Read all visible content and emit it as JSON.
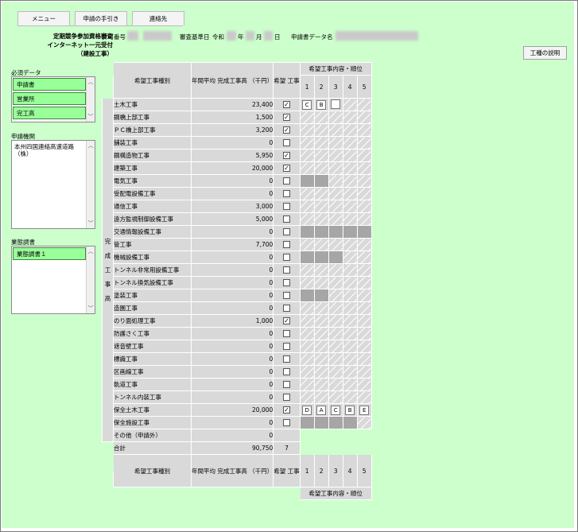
{
  "nav": {
    "tabs": [
      "メニュー",
      "申請の手引き",
      "連絡先"
    ]
  },
  "header": {
    "title_lines": [
      "定期競争参加資格審査",
      "インターネット一元受付",
      "（建設工事）"
    ],
    "permit_label": "許可番号",
    "base_date_label": "審査基準日",
    "era": "令和",
    "year_unit": "年",
    "month_unit": "月",
    "day_unit": "日",
    "data_name_label": "申請書データ名",
    "explain_button": "工種の説明"
  },
  "sidebar": {
    "required": {
      "label": "必須データ",
      "items": [
        "申請書",
        "営業所",
        "完工高"
      ]
    },
    "agency": {
      "label": "申請機関",
      "items": [
        "本州四国連絡高速道路（株）"
      ]
    },
    "status": {
      "label": "業態調書",
      "items": [
        "業態調書１"
      ]
    }
  },
  "table": {
    "headers": {
      "kind": "希望工事種別",
      "avg": "年間平均 完成工事高 （千円）",
      "hope": "希望 工事",
      "rank_group": "希望工事内容・順位",
      "ranks": [
        "1",
        "2",
        "3",
        "4",
        "5"
      ]
    },
    "side_label": [
      "完",
      "成",
      "工",
      "事",
      "高"
    ],
    "rows": [
      {
        "name": "土木工事",
        "value": "23,400",
        "checked": true,
        "ranks": [
          "C",
          "B",
          "",
          null,
          null
        ]
      },
      {
        "name": "鋼橋上部工事",
        "value": "1,500",
        "checked": true
      },
      {
        "name": "ＰＣ橋上部工事",
        "value": "3,200",
        "checked": true
      },
      {
        "name": "舗装工事",
        "value": "0",
        "checked": false
      },
      {
        "name": "鋼構造物工事",
        "value": "5,950",
        "checked": true
      },
      {
        "name": "建築工事",
        "value": "20,000",
        "checked": true
      },
      {
        "name": "電気工事",
        "value": "0",
        "checked": false
      },
      {
        "name": "受配電設備工事",
        "value": "0",
        "checked": false
      },
      {
        "name": "通信工事",
        "value": "3,000",
        "checked": false
      },
      {
        "name": "遠方監視制御設備工事",
        "value": "5,000",
        "checked": false
      },
      {
        "name": "交通情報設備工事",
        "value": "0",
        "checked": false
      },
      {
        "name": "管工事",
        "value": "7,700",
        "checked": false
      },
      {
        "name": "機械設備工事",
        "value": "0",
        "checked": false
      },
      {
        "name": "トンネル非常用設備工事",
        "value": "0",
        "checked": false
      },
      {
        "name": "トンネル換気設備工事",
        "value": "0",
        "checked": false
      },
      {
        "name": "塗装工事",
        "value": "0",
        "checked": false
      },
      {
        "name": "造園工事",
        "value": "0",
        "checked": false
      },
      {
        "name": "のり面処理工事",
        "value": "1,000",
        "checked": true
      },
      {
        "name": "防護さく工事",
        "value": "0",
        "checked": false
      },
      {
        "name": "遮音壁工事",
        "value": "0",
        "checked": false
      },
      {
        "name": "標識工事",
        "value": "0",
        "checked": false
      },
      {
        "name": "区画線工事",
        "value": "0",
        "checked": false
      },
      {
        "name": "軌道工事",
        "value": "0",
        "checked": false
      },
      {
        "name": "トンネル内装工事",
        "value": "0",
        "checked": false
      },
      {
        "name": "保全土木工事",
        "value": "20,000",
        "checked": true,
        "ranks": [
          "D",
          "A",
          "C",
          "B",
          "E"
        ]
      },
      {
        "name": "保全施設工事",
        "value": "0",
        "checked": false
      },
      {
        "name": "その他（申請外）",
        "value": "0",
        "checked": null
      },
      {
        "name": "合計",
        "value": "90,750",
        "count": "7"
      }
    ]
  }
}
